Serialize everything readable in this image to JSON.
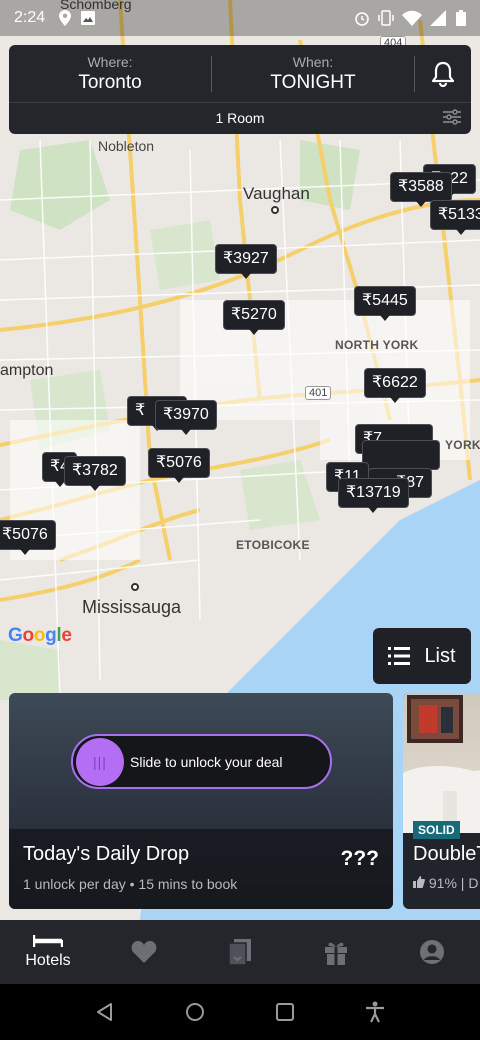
{
  "status_bar": {
    "time": "2:24",
    "left_icons": [
      "location-icon",
      "image-icon"
    ],
    "right_icons": [
      "alarm-icon",
      "vibrate-icon",
      "wifi-icon",
      "signal-icon",
      "battery-icon"
    ]
  },
  "search": {
    "where_label": "Where:",
    "where_value": "Toronto",
    "when_label": "When:",
    "when_value": "TONIGHT",
    "rooms": "1 Room"
  },
  "map": {
    "labels": {
      "schomberg": "Schomberg",
      "nobleton": "Nobleton",
      "vaughan": "Vaughan",
      "north_york": "NORTH YORK",
      "brampton": "ampton",
      "york": "YORK",
      "etobicoke": "ETOBICOKE",
      "mississauga": "Mississauga",
      "hwy_401": "401",
      "hwy_404": "404"
    },
    "pins": [
      "₹622",
      "₹3588",
      "₹5133",
      "₹3927",
      "₹5270",
      "₹5445",
      "₹6622",
      "₹3970",
      "₹",
      "₹7",
      "₹4",
      "₹3782",
      "₹5076",
      "₹11",
      "₹87",
      "₹13719",
      "₹5076"
    ],
    "attribution": "Google"
  },
  "list_button": {
    "label": "List"
  },
  "daily_drop": {
    "slider_text": "Slide to unlock your deal",
    "title": "Today's Daily Drop",
    "price": "???",
    "subtitle": "1 unlock per day • 15 mins to book"
  },
  "hotel_card": {
    "badge": "SOLID",
    "name": "DoubleT",
    "rating": "91% | D"
  },
  "bottom_nav": {
    "items": [
      {
        "label": "Hotels",
        "icon": "bed-icon",
        "active": true
      },
      {
        "label": "",
        "icon": "heart-icon",
        "active": false
      },
      {
        "label": "",
        "icon": "bookings-icon",
        "active": false
      },
      {
        "label": "",
        "icon": "gift-icon",
        "active": false
      },
      {
        "label": "",
        "icon": "account-icon",
        "active": false
      }
    ]
  },
  "colors": {
    "panel": "#24262b",
    "pin": "#1f2126",
    "accent_purple": "#b46ef4",
    "badge_teal": "#176a79",
    "water": "#a9d4f5"
  }
}
